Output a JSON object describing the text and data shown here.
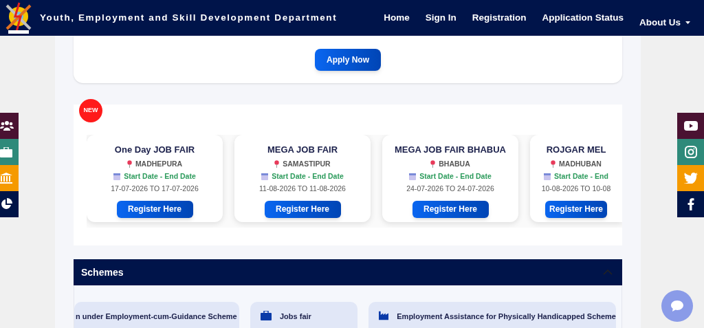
{
  "header": {
    "title": "Youth, Employment and Skill Development Department",
    "nav": [
      {
        "label": "Home",
        "kind": "link"
      },
      {
        "label": "Sign In",
        "kind": "link"
      },
      {
        "label": "Registration",
        "kind": "link"
      },
      {
        "label": "Application Status",
        "kind": "link"
      },
      {
        "label": "About Us",
        "kind": "dropdown"
      }
    ]
  },
  "apply_button": "Apply Now",
  "badge": "NEW",
  "job_fairs": [
    {
      "title": "One Day JOB FAIR",
      "location": "MADHEPURA",
      "date_label": "Start Date - End Date",
      "dates": "17-07-2026 TO 17-07-2026",
      "button": "Register Here"
    },
    {
      "title": "MEGA JOB FAIR",
      "location": "SAMASTIPUR",
      "date_label": "Start Date - End Date",
      "dates": "11-08-2026 TO 11-08-2026",
      "button": "Register Here"
    },
    {
      "title": "MEGA JOB FAIR BHABUA",
      "location": "BHABUA",
      "date_label": "Start Date - End Date",
      "dates": "24-07-2026 TO 24-07-2026",
      "button": "Register Here"
    },
    {
      "title": "ROJGAR MEL",
      "location": "MADHUBAN",
      "date_label": "Start Date - End",
      "dates": "10-08-2026 TO 10-08",
      "button": "Register Here"
    }
  ],
  "schemes": {
    "title": "Schemes",
    "expanded": true,
    "items": [
      {
        "label": "n under Employment-cum-Guidance Scheme"
      },
      {
        "label": "Jobs fair"
      },
      {
        "label": "Employment Assistance for Physically Handicapped Scheme"
      }
    ]
  },
  "left_links": [
    {
      "color": "#4a1232"
    },
    {
      "color": "#2e8a7a"
    },
    {
      "color": "#f59a00"
    },
    {
      "color": "#001447"
    }
  ],
  "right_links": [
    {
      "color": "#4a1232"
    },
    {
      "color": "#2e8a7a"
    },
    {
      "color": "#f59a00"
    },
    {
      "color": "#001447"
    }
  ]
}
